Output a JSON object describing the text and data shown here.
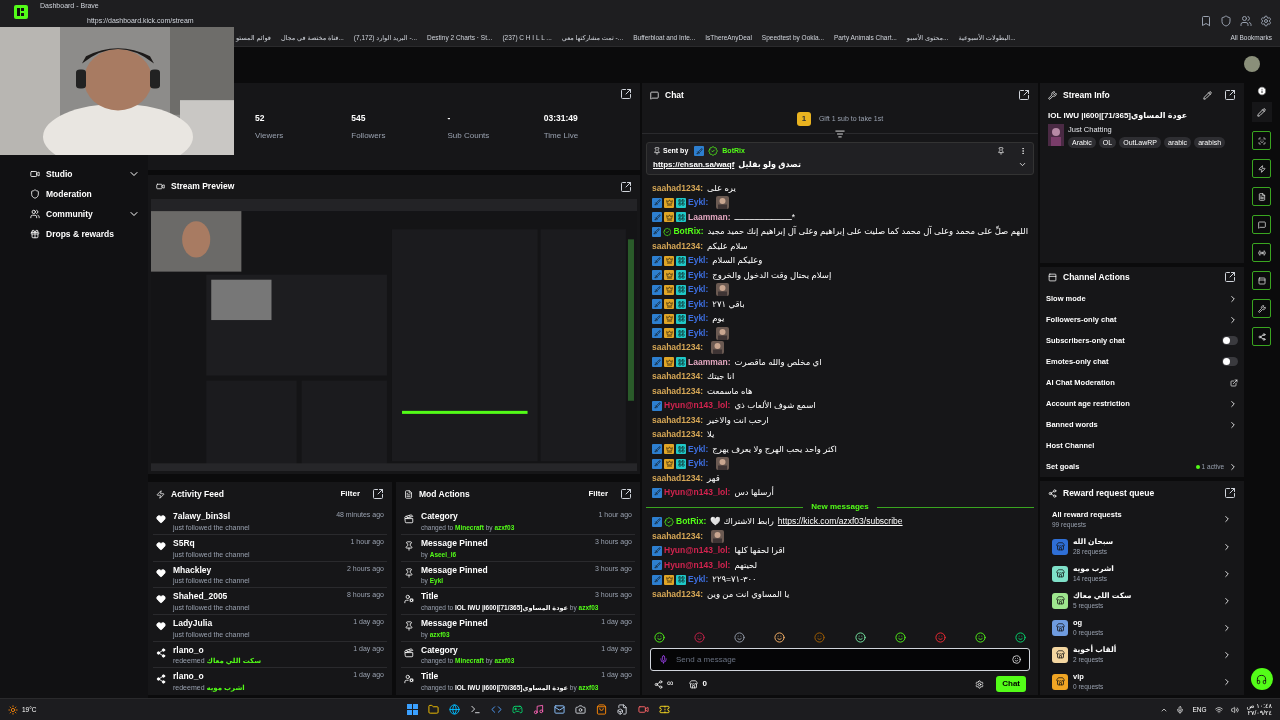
{
  "browser": {
    "title": "Dashboard - Brave",
    "url": "https://dashboard.kick.com/stream",
    "bookmarks": [
      "قوائم المستو",
      "قناة مختصة في مجال...",
      "(7,172) البريد الوارد -...",
      "Destiny 2 Charts · St...",
      "(237) C H I L L ...",
      "تمت مشاركتها معي -...",
      "Bufferbloat and Inte...",
      "IsThereAnyDeal",
      "Speedtest by Ookla...",
      "Party Animals Chart...",
      "محتوى الأسبو...",
      "البطولات الأسبوعية...",
      "All Bookmarks"
    ]
  },
  "sidebar": {
    "items": [
      {
        "label": "Studio",
        "expandable": true
      },
      {
        "label": "Moderation",
        "expandable": false
      },
      {
        "label": "Community",
        "expandable": true
      },
      {
        "label": "Drops & rewards",
        "expandable": false
      }
    ]
  },
  "stats": [
    {
      "value": "52",
      "label": "Viewers"
    },
    {
      "value": "545",
      "label": "Followers"
    },
    {
      "value": "-",
      "label": "Sub Counts"
    },
    {
      "value": "03:31:49",
      "label": "Time Live"
    }
  ],
  "stream_preview": {
    "title": "Stream Preview"
  },
  "activity_feed": {
    "title": "Activity Feed",
    "filter": "Filter",
    "items": [
      {
        "kind": "follow",
        "user": "7alawy_bin3sl",
        "time": "48 minutes ago",
        "note": "just followed the channel"
      },
      {
        "kind": "follow",
        "user": "S5Rq",
        "time": "1 hour ago",
        "note": "just followed the channel"
      },
      {
        "kind": "follow",
        "user": "Mhackley",
        "time": "2 hours ago",
        "note": "just followed the channel"
      },
      {
        "kind": "follow",
        "user": "Shahed_2005",
        "time": "8 hours ago",
        "note": "just followed the channel"
      },
      {
        "kind": "follow",
        "user": "LadyJulia",
        "time": "1 day ago",
        "note": "just followed the channel"
      },
      {
        "kind": "redeem",
        "user": "rlano_o",
        "time": "1 day ago",
        "note": "redeemed",
        "reward": "سكت اللي معاك"
      },
      {
        "kind": "redeem",
        "user": "rlano_o",
        "time": "1 day ago",
        "note": "redeemed",
        "reward": "اشرب مويه"
      }
    ]
  },
  "mod_actions": {
    "title": "Mod Actions",
    "filter": "Filter",
    "items": [
      {
        "kind": "category",
        "title": "Category",
        "time": "1 hour ago",
        "prefix": "changed to",
        "value": "Minecraft",
        "by": "by",
        "user": "azxf03"
      },
      {
        "kind": "pin",
        "title": "Message Pinned",
        "time": "3 hours ago",
        "by": "by",
        "user": "Aseel_l6"
      },
      {
        "kind": "pin",
        "title": "Message Pinned",
        "time": "3 hours ago",
        "by": "by",
        "user": "Eykl"
      },
      {
        "kind": "title",
        "title": "Title",
        "time": "3 hours ago",
        "prefix": "changed to",
        "value": "IOL IWU |I600|[71/365]عودة المساوي",
        "by": "by",
        "user": "azxf03"
      },
      {
        "kind": "pin",
        "title": "Message Pinned",
        "time": "1 day ago",
        "by": "by",
        "user": "azxf03"
      },
      {
        "kind": "category",
        "title": "Category",
        "time": "1 day ago",
        "prefix": "changed to",
        "value": "Minecraft",
        "by": "by",
        "user": "azxf03"
      },
      {
        "kind": "title",
        "title": "Title",
        "time": "1 day ago",
        "prefix": "changed to",
        "value": "IOL IWU |I600|[70/365]عودة المساوي",
        "by": "by",
        "user": "azxf03"
      }
    ]
  },
  "chat": {
    "title": "Chat",
    "gift": {
      "rank": "1",
      "text": "Gift 1 sub to take 1st"
    },
    "pinned": {
      "label": "Sent by",
      "user": "BotRix",
      "link": "https://ehsan.sa/waqf",
      "text": "تصدق ولو بقليل"
    },
    "messages": [
      {
        "kind": "message",
        "user": "saahad1234:",
        "color": "#d6a756",
        "text": "يره على"
      },
      {
        "kind": "message",
        "user": "Eykl:",
        "color": "#3d6fe0",
        "mod": true,
        "crown": true,
        "sub": true,
        "emote": true
      },
      {
        "kind": "message",
        "user": "Laamman:",
        "color": "#e3a7c0",
        "mod": true,
        "crown": true,
        "sub": true,
        "text": "*ـــــــــــــــــــــــ"
      },
      {
        "kind": "message",
        "user": "BotRix:",
        "color": "#53fc18",
        "mod": true,
        "verified": true,
        "text": "اللهم صلِّ على محمد وعلى آل محمد كما صليت على إبراهيم وعلى آل إبراهيم إنك حميد مجيد"
      },
      {
        "kind": "message",
        "user": "saahad1234:",
        "color": "#d6a756",
        "text": "سلام عليكم"
      },
      {
        "kind": "message",
        "user": "Eykl:",
        "color": "#3d6fe0",
        "mod": true,
        "crown": true,
        "sub": true,
        "text": "وعليكم السلام"
      },
      {
        "kind": "message",
        "user": "Eykl:",
        "color": "#3d6fe0",
        "mod": true,
        "crown": true,
        "sub": true,
        "text": "إسلام يحتال وقت الدخول والخروج"
      },
      {
        "kind": "message",
        "user": "Eykl:",
        "color": "#3d6fe0",
        "mod": true,
        "crown": true,
        "sub": true,
        "emote": true
      },
      {
        "kind": "message",
        "user": "Eykl:",
        "color": "#3d6fe0",
        "mod": true,
        "crown": true,
        "sub": true,
        "text": "باقي ٢٧١"
      },
      {
        "kind": "message",
        "user": "Eykl:",
        "color": "#3d6fe0",
        "mod": true,
        "crown": true,
        "sub": true,
        "text": "يوم"
      },
      {
        "kind": "message",
        "user": "Eykl:",
        "color": "#3d6fe0",
        "mod": true,
        "crown": true,
        "sub": true,
        "emote": true
      },
      {
        "kind": "message",
        "user": "saahad1234:",
        "color": "#d6a756",
        "emote": true
      },
      {
        "kind": "message",
        "user": "Laamman:",
        "color": "#e3a7c0",
        "mod": true,
        "crown": true,
        "sub": true,
        "text": "اي مخلص والله ماقصرت"
      },
      {
        "kind": "message",
        "user": "saahad1234:",
        "color": "#d6a756",
        "text": "انا جيتك"
      },
      {
        "kind": "message",
        "user": "saahad1234:",
        "color": "#d6a756",
        "text": "هاه ماسمعت"
      },
      {
        "kind": "message",
        "user": "Hyun@n143_lol:",
        "color": "#d3234f",
        "mod": true,
        "text": "اسمع شوف الألعاب ذي"
      },
      {
        "kind": "message",
        "user": "saahad1234:",
        "color": "#d6a756",
        "text": "ارحب انت والاخير"
      },
      {
        "kind": "message",
        "user": "saahad1234:",
        "color": "#d6a756",
        "text": "يلا"
      },
      {
        "kind": "message",
        "user": "Eykl:",
        "color": "#3d6fe0",
        "mod": true,
        "crown": true,
        "sub": true,
        "text": "اكثر واحد يحب الهرج ولا يعرف يهرج"
      },
      {
        "kind": "message",
        "user": "Eykl:",
        "color": "#3d6fe0",
        "mod": true,
        "crown": true,
        "sub": true,
        "emote": true
      },
      {
        "kind": "message",
        "user": "saahad1234:",
        "color": "#d6a756",
        "text": "قهر"
      },
      {
        "kind": "message",
        "user": "Hyun@n143_lol:",
        "color": "#d3234f",
        "mod": true,
        "text": "أرسلها دس"
      },
      {
        "kind": "divider",
        "text": "New messages"
      },
      {
        "kind": "message",
        "user": "BotRix:",
        "color": "#53fc18",
        "mod": true,
        "verified": true,
        "text": "رابط الاشتراك 🤍",
        "link": "https://kick.com/azxf03/subscribe"
      },
      {
        "kind": "message",
        "user": "saahad1234:",
        "color": "#d6a756",
        "emote": true
      },
      {
        "kind": "message",
        "user": "Hyun@n143_lol:",
        "color": "#d3234f",
        "mod": true,
        "text": "اقرا لحقها كلها"
      },
      {
        "kind": "message",
        "user": "Hyun@n143_lol:",
        "color": "#d3234f",
        "mod": true,
        "text": "لحيتهم"
      },
      {
        "kind": "message",
        "user": "Eykl:",
        "color": "#3d6fe0",
        "mod": true,
        "crown": true,
        "sub": true,
        "text": "٣٠٠-٧١=٢٢٩"
      },
      {
        "kind": "message",
        "user": "saahad1234:",
        "color": "#d6a756",
        "text": "يا المساوي انت من وين"
      }
    ],
    "input": {
      "placeholder": "Send a message"
    },
    "points": "∞",
    "store_count": "0",
    "send": "Chat"
  },
  "stream_info": {
    "title": "Stream Info",
    "stream_title": "IOL IWU |I600|[71/365]عودة المساوي",
    "category": "Just Chatting",
    "tags": [
      "Arabic",
      "OL",
      "OutLawRP",
      "arabic",
      "arabish"
    ]
  },
  "channel_actions": {
    "title": "Channel Actions",
    "items": [
      {
        "kind": "link",
        "label": "Slow mode"
      },
      {
        "kind": "link",
        "label": "Followers-only chat"
      },
      {
        "kind": "toggle",
        "label": "Subscribers-only chat",
        "on": false
      },
      {
        "kind": "toggle",
        "label": "Emotes-only chat",
        "on": false
      },
      {
        "kind": "external",
        "label": "AI Chat Moderation"
      },
      {
        "kind": "link",
        "label": "Account age restriction"
      },
      {
        "kind": "link",
        "label": "Banned words"
      },
      {
        "kind": "plain",
        "label": "Host Channel"
      },
      {
        "kind": "goal",
        "label": "Set goals",
        "badge": "1 active"
      }
    ]
  },
  "reward_queue": {
    "title": "Reward request queue",
    "all": {
      "label": "All reward requests",
      "count": "99 requests"
    },
    "items": [
      {
        "label": "سبحان الله",
        "count": "28 requests",
        "color": "#2f6fd6"
      },
      {
        "label": "اشرب مويه",
        "count": "14 requests",
        "color": "#7fe0c8"
      },
      {
        "label": "سكت اللي معاك",
        "count": "5 requests",
        "color": "#9ee68e"
      },
      {
        "label": "og",
        "count": "0 requests",
        "color": "#6f9ce0"
      },
      {
        "label": "ألقاب أخوية",
        "count": "2 requests",
        "color": "#f3d6a0"
      },
      {
        "label": "vip",
        "count": "0 requests",
        "color": "#f0a524"
      }
    ]
  },
  "taskbar": {
    "weather": "19°C",
    "language": "ENG",
    "time": "١٠:٤٨ ص",
    "date": "٢٧/٠٩/٢٤"
  }
}
